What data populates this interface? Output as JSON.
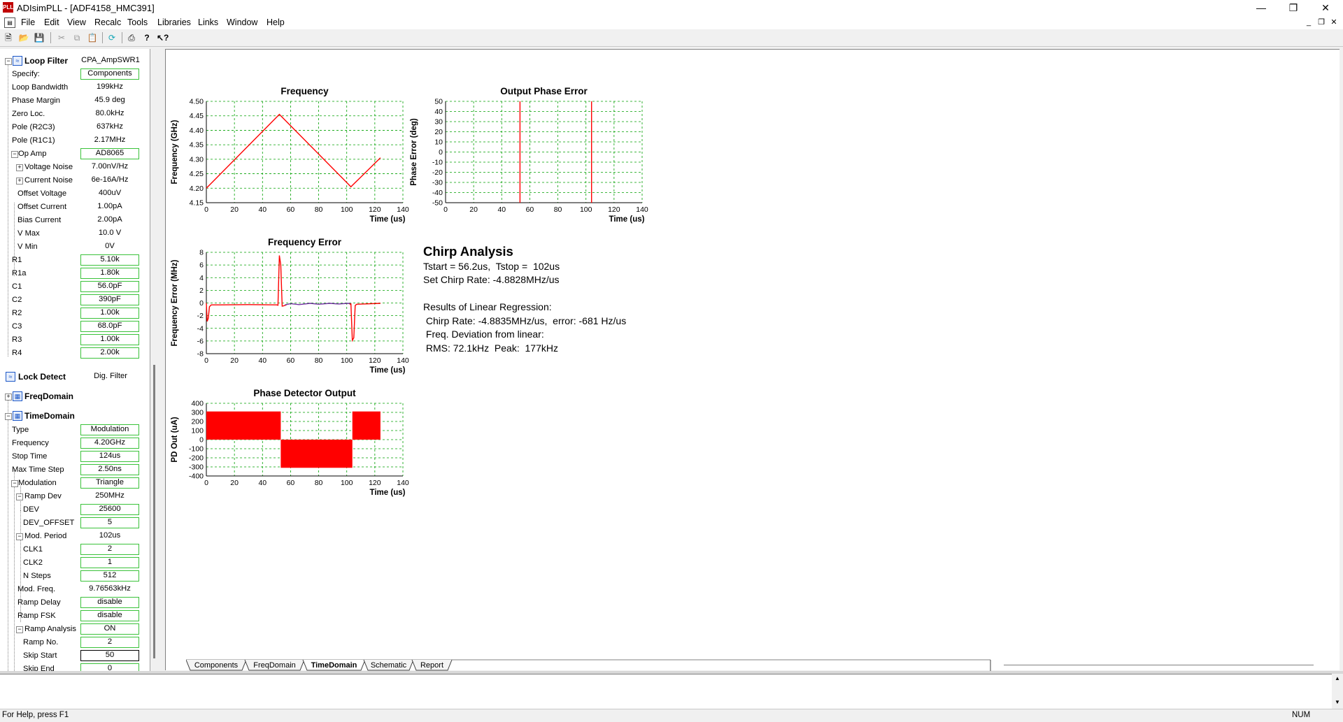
{
  "window": {
    "title": "ADIsimPLL - [ADF4158_HMC391]",
    "app_icon_text": "PLL"
  },
  "menu": [
    "File",
    "Edit",
    "View",
    "Recalc",
    "Tools",
    "Libraries",
    "Links",
    "Window",
    "Help"
  ],
  "toolbar": [
    "new-icon",
    "open-icon",
    "save-icon",
    "cut-icon",
    "copy-icon",
    "paste-icon",
    "recalc-icon",
    "print-icon",
    "help-icon",
    "context-help-icon"
  ],
  "left_panel": {
    "loop_filter": {
      "title": "Loop Filter",
      "value": "CPA_AmpSWR1"
    },
    "loop_filter_rows": [
      {
        "label": "Specify:",
        "value": "Components",
        "box": true
      },
      {
        "label": "Loop Bandwidth",
        "value": "199kHz"
      },
      {
        "label": "Phase Margin",
        "value": "45.9 deg"
      },
      {
        "label": "Zero Loc.",
        "value": "80.0kHz"
      },
      {
        "label": "Pole (R2C3)",
        "value": "637kHz"
      },
      {
        "label": "Pole (R1C1)",
        "value": "2.17MHz"
      },
      {
        "label": "Op Amp",
        "value": "AD8065",
        "box": true,
        "tree": "−",
        "indent": 1
      },
      {
        "label": "Voltage Noise",
        "value": "7.00nV/Hz",
        "tree": "+",
        "indent": 2
      },
      {
        "label": "Current Noise",
        "value": "6e-16A/Hz",
        "tree": "+",
        "indent": 2
      },
      {
        "label": "Offset Voltage",
        "value": "400uV",
        "indent": 2
      },
      {
        "label": "Offset Current",
        "value": "1.00pA",
        "indent": 2
      },
      {
        "label": "Bias Current",
        "value": "2.00pA",
        "indent": 2
      },
      {
        "label": "V Max",
        "value": "10.0 V",
        "indent": 2
      },
      {
        "label": "V Min",
        "value": "0V",
        "indent": 2
      },
      {
        "label": "R1",
        "value": "5.10k",
        "box": true
      },
      {
        "label": "R1a",
        "value": "1.80k",
        "box": true
      },
      {
        "label": "C1",
        "value": "56.0pF",
        "box": true
      },
      {
        "label": "C2",
        "value": "390pF",
        "box": true
      },
      {
        "label": "R2",
        "value": "1.00k",
        "box": true
      },
      {
        "label": "C3",
        "value": "68.0pF",
        "box": true
      },
      {
        "label": "R3",
        "value": "1.00k",
        "box": true
      },
      {
        "label": "R4",
        "value": "2.00k",
        "box": true
      }
    ],
    "lock_detect": {
      "title": "Lock Detect",
      "value": "Dig. Filter"
    },
    "freq_domain": {
      "title": "FreqDomain"
    },
    "time_domain": {
      "title": "TimeDomain"
    },
    "time_domain_rows": [
      {
        "label": "Type",
        "value": "Modulation",
        "box": true
      },
      {
        "label": "Frequency",
        "value": "4.20GHz",
        "box": true
      },
      {
        "label": "Stop Time",
        "value": "124us",
        "box": true
      },
      {
        "label": "Max Time Step",
        "value": "2.50ns",
        "box": true
      },
      {
        "label": "Modulation",
        "value": "Triangle",
        "box": true,
        "tree": "−",
        "indent": 1
      },
      {
        "label": "Ramp Dev",
        "value": "250MHz",
        "tree": "−",
        "indent": 2
      },
      {
        "label": "DEV",
        "value": "25600",
        "box": true,
        "indent": 3
      },
      {
        "label": "DEV_OFFSET",
        "value": "5",
        "box": true,
        "indent": 3
      },
      {
        "label": "Mod. Period",
        "value": "102us",
        "tree": "−",
        "indent": 2
      },
      {
        "label": "CLK1",
        "value": "2",
        "box": true,
        "indent": 3
      },
      {
        "label": "CLK2",
        "value": "1",
        "box": true,
        "indent": 3
      },
      {
        "label": "N Steps",
        "value": "512",
        "box": true,
        "indent": 3
      },
      {
        "label": "Mod. Freq.",
        "value": "9.76563kHz",
        "indent": 2
      },
      {
        "label": "Ramp Delay",
        "value": "disable",
        "box": true,
        "indent": 2
      },
      {
        "label": "Ramp FSK",
        "value": "disable",
        "box": true,
        "indent": 2
      },
      {
        "label": "Ramp Analysis",
        "value": "ON",
        "box": true,
        "tree": "−",
        "indent": 2
      },
      {
        "label": "Ramp No.",
        "value": "2",
        "box": true,
        "indent": 3
      },
      {
        "label": "Skip Start",
        "value": "50",
        "box": true,
        "indent": 3,
        "selected": true
      },
      {
        "label": "Skip End",
        "value": "0",
        "box": true,
        "indent": 3
      }
    ]
  },
  "chart_data": [
    {
      "type": "line",
      "title": "Frequency",
      "xlabel": "Time (us)",
      "ylabel": "Frequency (GHz)",
      "xlim": [
        0,
        140
      ],
      "ylim": [
        4.15,
        4.5
      ],
      "xticks": [
        0,
        20,
        40,
        60,
        80,
        100,
        120,
        140
      ],
      "yticks": [
        4.15,
        4.2,
        4.25,
        4.3,
        4.35,
        4.4,
        4.45,
        4.5
      ],
      "ytick_labels": [
        "4.15",
        "4.20",
        "4.25",
        "4.30",
        "4.35",
        "4.40",
        "4.45",
        "4.50"
      ],
      "grid": true,
      "series": [
        {
          "color": "#ff0000",
          "points": [
            [
              0,
              4.2
            ],
            [
              52,
              4.455
            ],
            [
              103,
              4.205
            ],
            [
              124,
              4.305
            ]
          ]
        }
      ]
    },
    {
      "type": "line",
      "title": "Output Phase Error",
      "xlabel": "Time (us)",
      "ylabel": "Phase Error (deg)",
      "xlim": [
        0,
        140
      ],
      "ylim": [
        -50,
        50
      ],
      "xticks": [
        0,
        20,
        40,
        60,
        80,
        100,
        120,
        140
      ],
      "yticks": [
        -50,
        -40,
        -30,
        -20,
        -10,
        0,
        10,
        20,
        30,
        40,
        50
      ],
      "ytick_labels": [
        "-50",
        "-40",
        "-30",
        "-20",
        "-10",
        "0",
        "10",
        "20",
        "30",
        "40",
        "50"
      ],
      "grid": true,
      "series": [
        {
          "color": "#ff0000",
          "points": [
            [
              53,
              -50
            ],
            [
              53,
              50
            ]
          ]
        },
        {
          "color": "#ff0000",
          "points": [
            [
              104,
              -50
            ],
            [
              104,
              50
            ]
          ]
        }
      ]
    },
    {
      "type": "line",
      "title": "Frequency Error",
      "xlabel": "Time (us)",
      "ylabel": "Frequency Error (MHz)",
      "xlim": [
        0,
        140
      ],
      "ylim": [
        -8,
        8
      ],
      "xticks": [
        0,
        20,
        40,
        60,
        80,
        100,
        120,
        140
      ],
      "yticks": [
        -8,
        -6,
        -4,
        -2,
        0,
        2,
        4,
        6,
        8
      ],
      "ytick_labels": [
        "-8",
        "-6",
        "-4",
        "-2",
        "0",
        "2",
        "4",
        "6",
        "8"
      ],
      "grid": true,
      "series": [
        {
          "color": "#ff0000",
          "points": [
            [
              0,
              0
            ],
            [
              0.6,
              -2.9
            ],
            [
              1.4,
              -2.4
            ],
            [
              2.2,
              -0.6
            ],
            [
              3.5,
              -0.3
            ],
            [
              10,
              -0.3
            ],
            [
              30,
              -0.25
            ],
            [
              50,
              -0.3
            ],
            [
              51,
              -0.35
            ],
            [
              52,
              7.5
            ],
            [
              53,
              6.0
            ],
            [
              54,
              -0.5
            ],
            [
              55,
              -0.45
            ],
            [
              57,
              -0.3
            ]
          ]
        },
        {
          "color": "#7030a0",
          "points": [
            [
              56,
              -0.3
            ],
            [
              60,
              -0.1
            ],
            [
              66,
              -0.25
            ],
            [
              74,
              -0.05
            ],
            [
              80,
              -0.2
            ],
            [
              88,
              -0.05
            ],
            [
              94,
              -0.15
            ],
            [
              101,
              -0.05
            ],
            [
              103,
              -0.1
            ]
          ]
        },
        {
          "color": "#ff0000",
          "points": [
            [
              102,
              -0.2
            ],
            [
              103,
              -0.15
            ],
            [
              104,
              -5.9
            ],
            [
              105,
              -5.5
            ],
            [
              106,
              -0.4
            ],
            [
              107,
              -0.2
            ],
            [
              112,
              -0.15
            ],
            [
              124,
              -0.05
            ]
          ]
        }
      ]
    },
    {
      "type": "area",
      "title": "Phase Detector Output",
      "xlabel": "Time (us)",
      "ylabel": "PD Out (uA)",
      "xlim": [
        0,
        140
      ],
      "ylim": [
        -400,
        400
      ],
      "xticks": [
        0,
        20,
        40,
        60,
        80,
        100,
        120,
        140
      ],
      "yticks": [
        -400,
        -300,
        -200,
        -100,
        0,
        100,
        200,
        300,
        400
      ],
      "ytick_labels": [
        "-400",
        "-300",
        "-200",
        "-100",
        "0",
        "100",
        "200",
        "300",
        "400"
      ],
      "grid": true,
      "series": [
        {
          "color": "#ff0000",
          "blocks": [
            [
              0,
              53,
              0,
              310
            ],
            [
              53,
              104,
              -310,
              0
            ],
            [
              104,
              124,
              0,
              310
            ]
          ]
        }
      ]
    }
  ],
  "chirp": {
    "title": "Chirp Analysis",
    "lines": [
      "Tstart = 56.2us,  Tstop =  102us",
      "Set Chirp Rate: -4.8828MHz/us",
      "",
      "Results of Linear Regression:",
      " Chirp Rate: -4.8835MHz/us,  error: -681 Hz/us",
      " Freq. Deviation from linear:",
      " RMS: 72.1kHz  Peak:  177kHz"
    ]
  },
  "tabs": [
    "Components",
    "FreqDomain",
    "TimeDomain",
    "Schematic",
    "Report"
  ],
  "active_tab": "TimeDomain",
  "status": {
    "help": "For Help, press F1",
    "num": "NUM"
  }
}
